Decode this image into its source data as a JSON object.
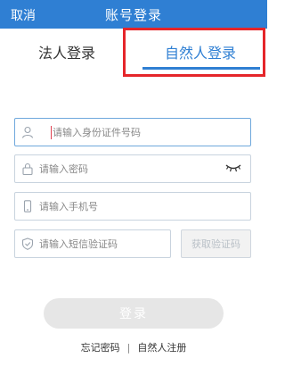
{
  "header": {
    "cancel_label": "取消",
    "title": "账号登录"
  },
  "tabs": {
    "legal_person": "法人登录",
    "natural_person": "自然人登录",
    "active": "natural_person"
  },
  "form": {
    "id_number": {
      "placeholder": "请输入身份证件号码",
      "value": "",
      "icon": "user-icon"
    },
    "password": {
      "placeholder": "请输入密码",
      "value": "",
      "icon": "lock-icon",
      "toggle_icon": "eye-closed-icon"
    },
    "phone": {
      "placeholder": "请输入手机号",
      "value": "",
      "icon": "phone-icon"
    },
    "sms_code": {
      "placeholder": "请输入短信验证码",
      "value": "",
      "icon": "shield-icon"
    },
    "get_code_label": "获取验证码"
  },
  "login_button_label": "登录",
  "links": {
    "forgot_password": "忘记密码",
    "separator": "|",
    "register": "自然人注册"
  },
  "colors": {
    "brand_blue": "#2f7fd3",
    "highlight_red": "#e5252a",
    "disabled_gray": "#e6e6e6"
  }
}
